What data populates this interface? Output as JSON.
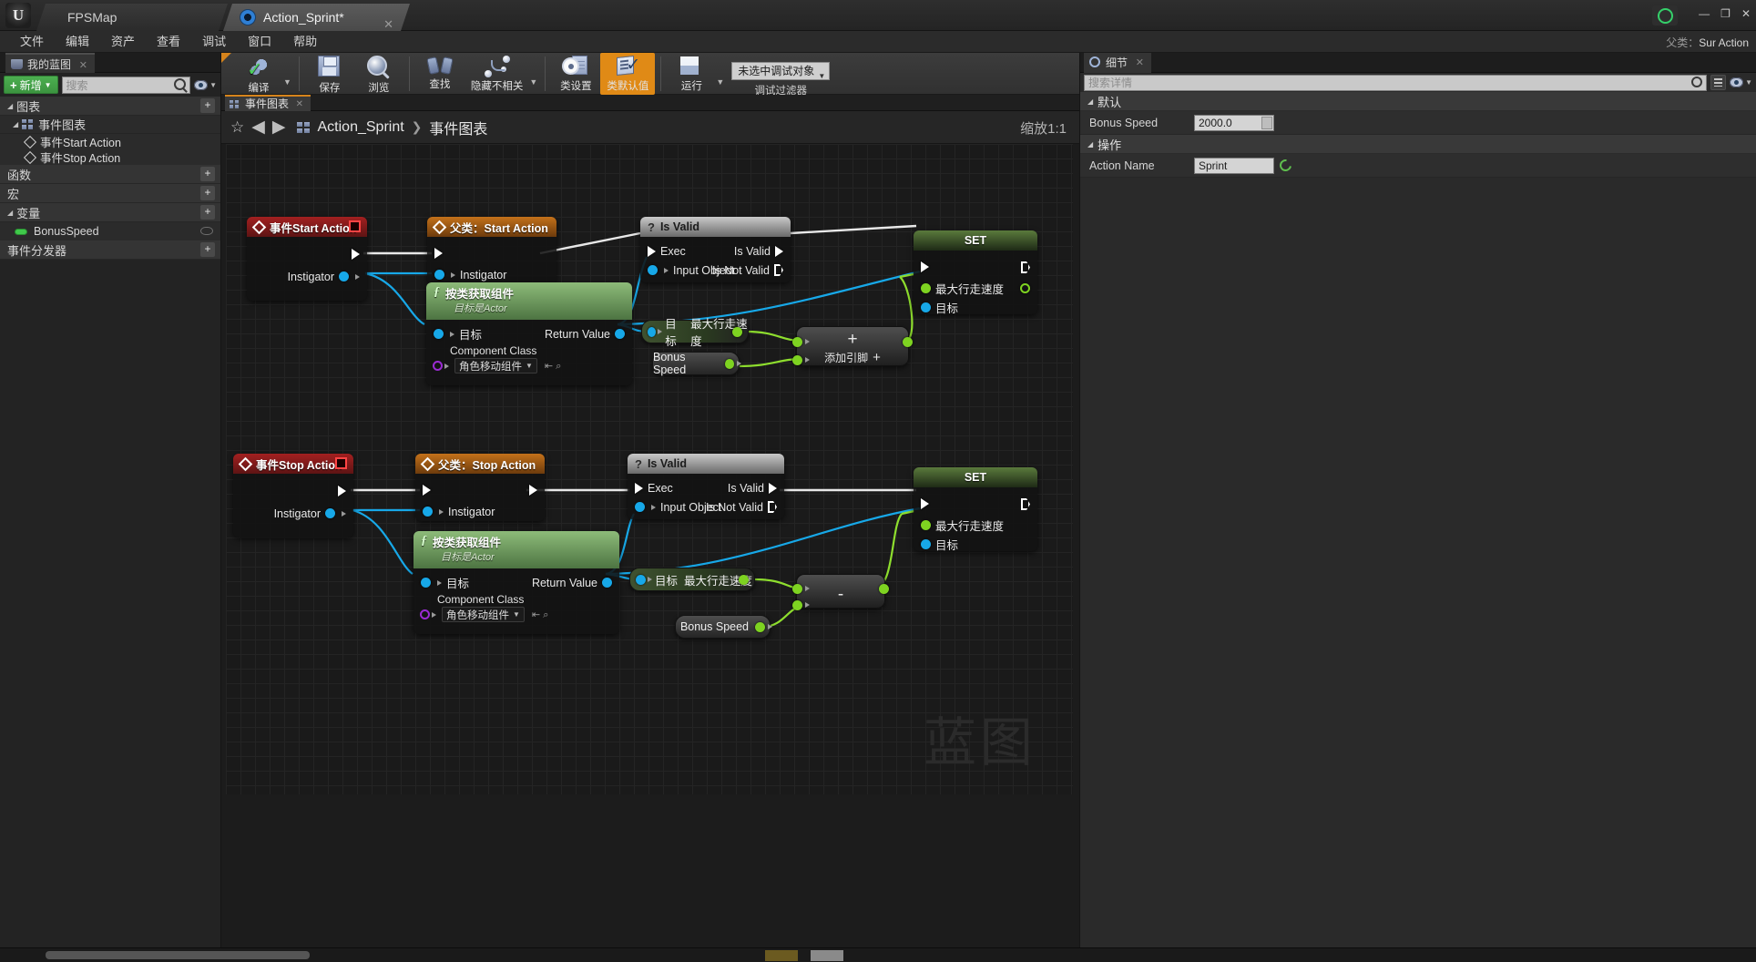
{
  "titlebar": {
    "logo": "unreal-logo",
    "map_tab": "FPSMap",
    "blueprint_tab": "Action_Sprint*",
    "close_label": "✕",
    "minimize": "—",
    "maximize": "❐",
    "close_window": "✕"
  },
  "menu": {
    "items": [
      "文件",
      "编辑",
      "资产",
      "查看",
      "调试",
      "窗口",
      "帮助"
    ],
    "parent_class_label": "父类：",
    "parent_class_value": "Sur Action"
  },
  "left_panel": {
    "tab_title": "我的蓝图",
    "tab_close": "✕",
    "add_button": "新增",
    "add_carat": "▼",
    "search_placeholder": "搜索",
    "sections": [
      {
        "label": "图表",
        "has_plus": true
      },
      {
        "label": "事件图表",
        "has_plus": false
      },
      {
        "label": "函数",
        "has_plus": true
      },
      {
        "label": "宏",
        "has_plus": true
      },
      {
        "label": "变量",
        "has_plus": true
      },
      {
        "label": "事件分发器",
        "has_plus": true
      }
    ],
    "graph_events": [
      "事件Start Action",
      "事件Stop Action"
    ],
    "variables": [
      "BonusSpeed"
    ],
    "plus_glyph": "+"
  },
  "toolbar": {
    "items": [
      {
        "label": "编译",
        "icon": "compile-icon",
        "has_dropdown": true
      },
      {
        "label": "保存",
        "icon": "save-icon",
        "has_dropdown": false
      },
      {
        "label": "浏览",
        "icon": "browse-icon",
        "has_dropdown": false
      },
      {
        "label": "查找",
        "icon": "find-icon",
        "has_dropdown": false
      },
      {
        "label": "隐藏不相关",
        "icon": "hide-unrelated-icon",
        "has_dropdown": true
      },
      {
        "label": "类设置",
        "icon": "class-settings-icon",
        "has_dropdown": false
      },
      {
        "label": "类默认值",
        "icon": "class-defaults-icon",
        "has_dropdown": false,
        "active": true
      },
      {
        "label": "运行",
        "icon": "play-icon",
        "has_dropdown": true
      }
    ],
    "debug_object": "未选中调试对象",
    "debug_carat": "▼",
    "debug_filter_label": "调试过滤器"
  },
  "graph": {
    "tab_label": "事件图表",
    "tab_close": "✕",
    "breadcrumb_root": "Action_Sprint",
    "breadcrumb_sep": "❯",
    "breadcrumb_leaf": "事件图表",
    "zoom_label": "缩放1:1",
    "star": "☆",
    "back_arrow": "◀",
    "forward_arrow": "▶",
    "watermark": "蓝图"
  },
  "nodes": {
    "event_start": {
      "title": "事件Start Action",
      "out_pins": [
        {
          "label": "",
          "type": "exec"
        },
        {
          "label": "Instigator",
          "type": "object"
        }
      ]
    },
    "parent_start": {
      "title": "父类：Start Action",
      "in_pins": [
        {
          "label": "",
          "type": "exec"
        },
        {
          "label": "Instigator",
          "type": "object"
        }
      ]
    },
    "get_component_1": {
      "title": "按类获取组件",
      "subtitle": "目标是Actor",
      "target_label": "目标",
      "return_label": "Return Value",
      "class_label": "Component Class",
      "class_value": "角色移动组件",
      "class_carat": "▼"
    },
    "is_valid_1": {
      "title": "Is Valid",
      "glyph": "?",
      "exec_label": "Exec",
      "input_label": "Input Object",
      "valid_label": "Is Valid",
      "not_valid_label": "Is Not Valid"
    },
    "set_1": {
      "title": "SET",
      "prop_label": "最大行走速度",
      "target_label": "目标"
    },
    "getter_1": {
      "target": "目标",
      "prop": "最大行走速度"
    },
    "bonus_1": {
      "label": "Bonus Speed"
    },
    "math_add": {
      "symbol": "+",
      "label": "添加引脚",
      "plus": "+"
    },
    "event_stop": {
      "title": "事件Stop Action",
      "out_pins": [
        {
          "label": "",
          "type": "exec"
        },
        {
          "label": "Instigator",
          "type": "object"
        }
      ]
    },
    "parent_stop": {
      "title": "父类：Stop Action",
      "in_pins": [
        {
          "label": "",
          "type": "exec"
        },
        {
          "label": "Instigator",
          "type": "object"
        }
      ]
    },
    "get_component_2": {
      "title": "按类获取组件",
      "subtitle": "目标是Actor",
      "target_label": "目标",
      "return_label": "Return Value",
      "class_label": "Component Class",
      "class_value": "角色移动组件",
      "class_carat": "▼"
    },
    "is_valid_2": {
      "title": "Is Valid",
      "glyph": "?",
      "exec_label": "Exec",
      "input_label": "Input Object",
      "valid_label": "Is Valid",
      "not_valid_label": "Is Not Valid"
    },
    "set_2": {
      "title": "SET",
      "prop_label": "最大行走速度",
      "target_label": "目标"
    },
    "getter_2": {
      "target": "目标",
      "prop": "最大行走速度"
    },
    "bonus_2": {
      "label": "Bonus Speed"
    },
    "math_sub": {
      "symbol": "-"
    }
  },
  "details": {
    "tab_title": "细节",
    "tab_close": "✕",
    "search_placeholder": "搜索详情",
    "categories": [
      {
        "label": "默认",
        "props": [
          {
            "key": "Bonus Speed",
            "value": "2000.0",
            "type": "number"
          }
        ]
      },
      {
        "label": "操作",
        "props": [
          {
            "key": "Action Name",
            "value": "Sprint",
            "type": "text"
          }
        ]
      }
    ],
    "tri": "◢"
  },
  "colors": {
    "accent_orange": "#e08a16",
    "exec_white": "#ffffff",
    "object_blue": "#17a8e8",
    "float_green": "#7ed321",
    "class_purple": "#9b2bd4",
    "event_red": "#a32020",
    "parent_orange": "#c4711a"
  }
}
